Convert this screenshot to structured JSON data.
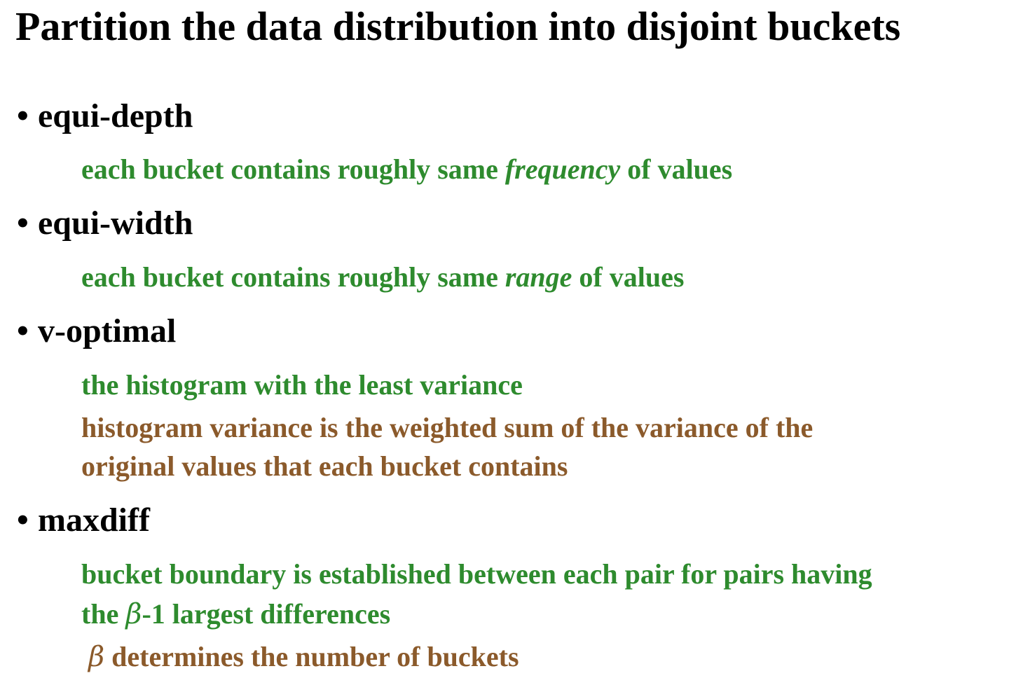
{
  "title": "Partition the data distribution into disjoint buckets",
  "bullet_glyph": "•",
  "items": [
    {
      "heading": "equi-depth",
      "lines": [
        {
          "pre": "each bucket contains roughly same ",
          "em": "frequency",
          "post": " of values"
        }
      ]
    },
    {
      "heading": "equi-width",
      "lines": [
        {
          "pre": "each bucket contains roughly same ",
          "em": "range",
          "post": " of values"
        }
      ]
    },
    {
      "heading": "v-optimal",
      "lines": [
        {
          "text": "the histogram with the least variance"
        },
        {
          "text": "histogram variance is the weighted sum of the variance of the"
        },
        {
          "text": "original values that each bucket contains"
        }
      ]
    },
    {
      "heading": "maxdiff",
      "lines": [
        {
          "text": "bucket boundary is established between each pair for pairs having"
        },
        {
          "pre": "the ",
          "sym": "β",
          "post": "-1 largest differences"
        },
        {
          "sym": "β",
          "post": " determines the number of buckets"
        }
      ]
    }
  ],
  "colors": {
    "heading": "#000000",
    "green": "#2e8b2e",
    "brown": "#8b5a2b"
  }
}
